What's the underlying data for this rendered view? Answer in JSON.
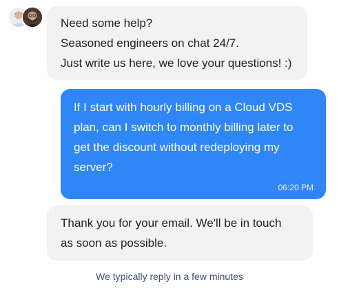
{
  "header": {
    "avatars": [
      "agent-avatar-1",
      "agent-avatar-2"
    ]
  },
  "messages": [
    {
      "sender": "agent",
      "lines": [
        "Need some help?",
        "Seasoned engineers on chat 24/7.",
        "Just write us here, we love your questions! :)"
      ]
    },
    {
      "sender": "user",
      "lines": [
        "If I start with hourly billing on a Cloud VDS",
        "plan, can I switch to monthly billing later to",
        "get the discount without redeploying my",
        "server?"
      ],
      "time": "06:20 PM"
    },
    {
      "sender": "agent",
      "lines": [
        "Thank you for your email. We'll be in touch",
        "as soon as possible."
      ]
    }
  ],
  "footer": {
    "note": "We typically reply in a few minutes"
  },
  "colors": {
    "incoming_bubble": "#f2f2f2",
    "outgoing_bubble": "#2f86f6",
    "footer_text": "#3c4f7a"
  }
}
